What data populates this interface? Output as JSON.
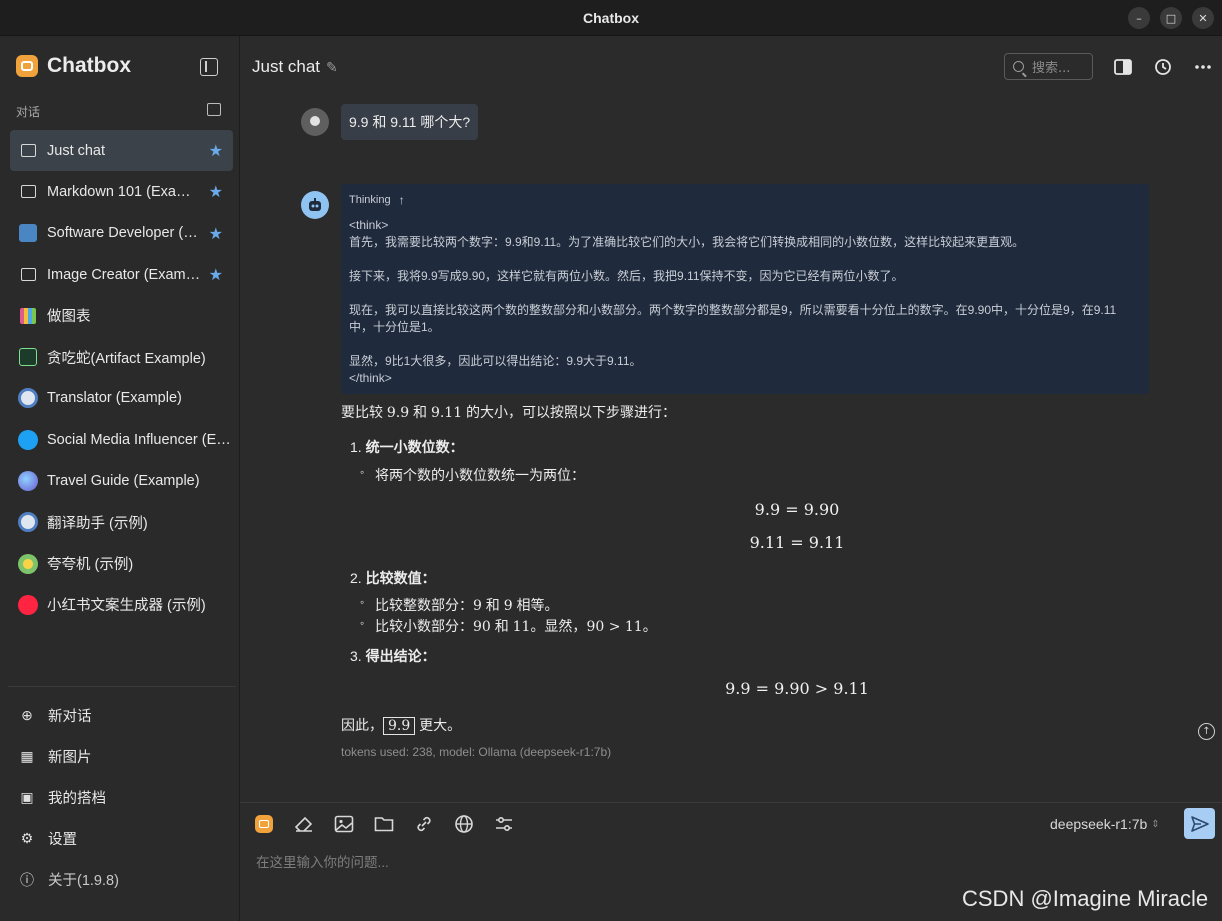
{
  "window": {
    "title": "Chatbox"
  },
  "sidebar": {
    "brand": "Chatbox",
    "section_label": "对话",
    "conversations": [
      {
        "label": "Just chat",
        "icon": "chat-bubble-icon",
        "starred": true,
        "active": true
      },
      {
        "label": "Markdown 101 (Example)",
        "icon": "chat-bubble-icon",
        "starred": true
      },
      {
        "label": "Software Developer (Example)",
        "icon": "developer-avatar-icon",
        "starred": true
      },
      {
        "label": "Image Creator (Example)",
        "icon": "image-icon",
        "starred": true
      },
      {
        "label": "做图表",
        "icon": "chart-avatar-icon"
      },
      {
        "label": "贪吃蛇(Artifact Example)",
        "icon": "snake-avatar-icon"
      },
      {
        "label": "Translator (Example)",
        "icon": "translator-avatar-icon"
      },
      {
        "label": "Social Media Influencer (Example)",
        "icon": "twitter-avatar-icon"
      },
      {
        "label": "Travel Guide (Example)",
        "icon": "globe-avatar-icon"
      },
      {
        "label": "翻译助手 (示例)",
        "icon": "translator-avatar-icon"
      },
      {
        "label": "夸夸机 (示例)",
        "icon": "cheer-avatar-icon"
      },
      {
        "label": "小红书文案生成器 (示例)",
        "icon": "xiaohongshu-avatar-icon"
      }
    ],
    "actions": [
      {
        "label": "新对话",
        "icon": "plus-circle-icon"
      },
      {
        "label": "新图片",
        "icon": "add-image-icon"
      },
      {
        "label": "我的搭档",
        "icon": "robot-icon"
      },
      {
        "label": "设置",
        "icon": "gear-icon"
      },
      {
        "label": "关于(1.9.8)",
        "icon": "info-icon"
      }
    ]
  },
  "header": {
    "chat_title": "Just chat",
    "search_placeholder": "搜索..."
  },
  "messages": {
    "user": "9.9 和 9.11 哪个大?",
    "thinking": {
      "label": "Thinking",
      "lines": [
        "<think>",
        "首先，我需要比较两个数字：9.9和9.11。为了准确比较它们的大小，我会将它们转换成相同的小数位数，这样比较起来更直观。",
        "",
        "接下来，我将9.9写成9.90，这样它就有两位小数。然后，我把9.11保持不变，因为它已经有两位小数了。",
        "",
        "现在，我可以直接比较这两个数的整数部分和小数部分。两个数字的整数部分都是9，所以需要看十分位上的数字。在9.90中，十分位是9，在9.11",
        "中，十分位是1。",
        "",
        "显然，9比1大很多，因此可以得出结论：9.9大于9.11。",
        "</think>"
      ]
    },
    "answer": {
      "intro_a": "要比较 ",
      "intro_n1": "9.9",
      "intro_b": " 和 ",
      "intro_n2": "9.11",
      "intro_c": " 的大小，可以按照以下步骤进行：",
      "step1_title": "统一小数位数",
      "step1_bullet": "将两个数的小数位数统一为两位：",
      "math1": "9.9 = 9.90",
      "math2": "9.11 = 9.11",
      "step2_title": "比较数值",
      "step2_b1_a": "比较整数部分：",
      "step2_b1_n1": "9",
      "step2_b1_b": " 和 ",
      "step2_b1_n2": "9",
      "step2_b1_c": " 相等。",
      "step2_b2_a": "比较小数部分：",
      "step2_b2_n1": "90",
      "step2_b2_b": " 和 ",
      "step2_b2_n2": "11",
      "step2_b2_c": "。显然，",
      "step2_b2_n3": "90 > 11",
      "step2_b2_d": "。",
      "step3_title": "得出结论",
      "math3": "9.9 = 9.90 > 9.11",
      "conclusion_a": "因此，",
      "conclusion_box": "9.9",
      "conclusion_b": " 更大。",
      "meta": "tokens used: 238, model: Ollama (deepseek-r1:7b)"
    }
  },
  "composer": {
    "model": "deepseek-r1:7b",
    "placeholder": "在这里输入你的问题..."
  },
  "watermark": "CSDN @Imagine Miracle",
  "colors": {
    "accent": "#6aa9ea",
    "send": "#a7cdf5",
    "thinking_bg": "#1f2a3c",
    "brand": "#f0a23c"
  }
}
